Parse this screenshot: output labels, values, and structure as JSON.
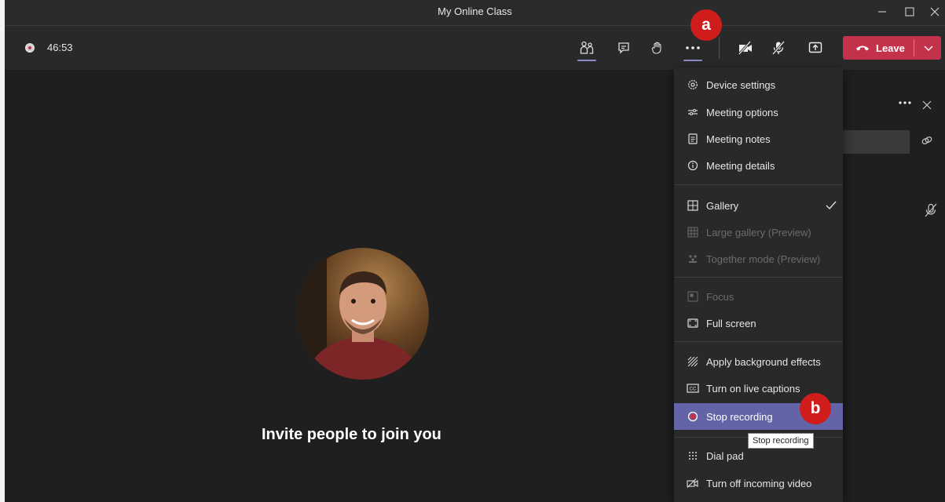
{
  "window": {
    "title": "My Online Class"
  },
  "toolbar": {
    "timer": "46:53",
    "leave_label": "Leave"
  },
  "stage": {
    "invite_text": "Invite people to join you"
  },
  "menu": {
    "items": [
      {
        "label": "Device settings",
        "icon": "gear-icon"
      },
      {
        "label": "Meeting options",
        "icon": "sliders-icon"
      },
      {
        "label": "Meeting notes",
        "icon": "notes-icon"
      },
      {
        "label": "Meeting details",
        "icon": "info-icon"
      },
      {
        "label": "Gallery",
        "icon": "grid-icon",
        "checked": true
      },
      {
        "label": "Large gallery (Preview)",
        "icon": "large-grid-icon",
        "disabled": true
      },
      {
        "label": "Together mode (Preview)",
        "icon": "people-group-icon",
        "disabled": true
      },
      {
        "label": "Focus",
        "icon": "focus-icon",
        "disabled": true
      },
      {
        "label": "Full screen",
        "icon": "fullscreen-icon"
      },
      {
        "label": "Apply background effects",
        "icon": "background-effects-icon"
      },
      {
        "label": "Turn on live captions",
        "icon": "cc-icon"
      },
      {
        "label": "Stop recording",
        "icon": "record-icon",
        "active": true
      },
      {
        "label": "Dial pad",
        "icon": "dialpad-icon"
      },
      {
        "label": "Turn off incoming video",
        "icon": "video-off-icon"
      }
    ]
  },
  "tooltip": {
    "text": "Stop recording"
  },
  "annotations": {
    "a": "a",
    "b": "b"
  },
  "colors": {
    "accent": "#6264a7",
    "leave": "#c4314b",
    "badge": "#d11c1c"
  }
}
